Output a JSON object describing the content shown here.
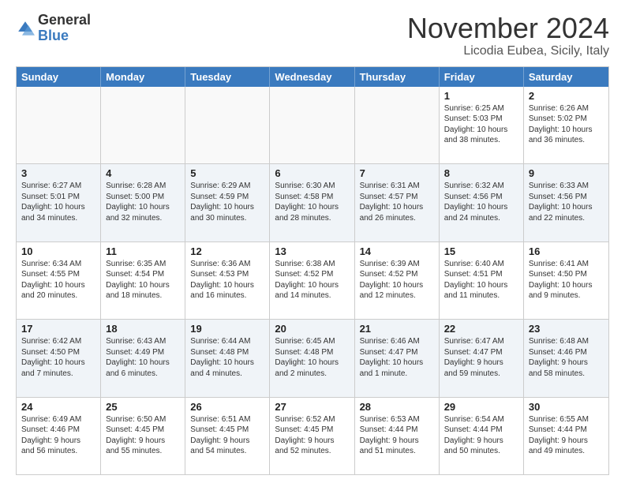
{
  "logo": {
    "general": "General",
    "blue": "Blue"
  },
  "title": "November 2024",
  "subtitle": "Licodia Eubea, Sicily, Italy",
  "headers": [
    "Sunday",
    "Monday",
    "Tuesday",
    "Wednesday",
    "Thursday",
    "Friday",
    "Saturday"
  ],
  "rows": [
    {
      "alt": false,
      "cells": [
        {
          "empty": true,
          "day": "",
          "info": ""
        },
        {
          "empty": true,
          "day": "",
          "info": ""
        },
        {
          "empty": true,
          "day": "",
          "info": ""
        },
        {
          "empty": true,
          "day": "",
          "info": ""
        },
        {
          "empty": true,
          "day": "",
          "info": ""
        },
        {
          "empty": false,
          "day": "1",
          "info": "Sunrise: 6:25 AM\nSunset: 5:03 PM\nDaylight: 10 hours\nand 38 minutes."
        },
        {
          "empty": false,
          "day": "2",
          "info": "Sunrise: 6:26 AM\nSunset: 5:02 PM\nDaylight: 10 hours\nand 36 minutes."
        }
      ]
    },
    {
      "alt": true,
      "cells": [
        {
          "empty": false,
          "day": "3",
          "info": "Sunrise: 6:27 AM\nSunset: 5:01 PM\nDaylight: 10 hours\nand 34 minutes."
        },
        {
          "empty": false,
          "day": "4",
          "info": "Sunrise: 6:28 AM\nSunset: 5:00 PM\nDaylight: 10 hours\nand 32 minutes."
        },
        {
          "empty": false,
          "day": "5",
          "info": "Sunrise: 6:29 AM\nSunset: 4:59 PM\nDaylight: 10 hours\nand 30 minutes."
        },
        {
          "empty": false,
          "day": "6",
          "info": "Sunrise: 6:30 AM\nSunset: 4:58 PM\nDaylight: 10 hours\nand 28 minutes."
        },
        {
          "empty": false,
          "day": "7",
          "info": "Sunrise: 6:31 AM\nSunset: 4:57 PM\nDaylight: 10 hours\nand 26 minutes."
        },
        {
          "empty": false,
          "day": "8",
          "info": "Sunrise: 6:32 AM\nSunset: 4:56 PM\nDaylight: 10 hours\nand 24 minutes."
        },
        {
          "empty": false,
          "day": "9",
          "info": "Sunrise: 6:33 AM\nSunset: 4:56 PM\nDaylight: 10 hours\nand 22 minutes."
        }
      ]
    },
    {
      "alt": false,
      "cells": [
        {
          "empty": false,
          "day": "10",
          "info": "Sunrise: 6:34 AM\nSunset: 4:55 PM\nDaylight: 10 hours\nand 20 minutes."
        },
        {
          "empty": false,
          "day": "11",
          "info": "Sunrise: 6:35 AM\nSunset: 4:54 PM\nDaylight: 10 hours\nand 18 minutes."
        },
        {
          "empty": false,
          "day": "12",
          "info": "Sunrise: 6:36 AM\nSunset: 4:53 PM\nDaylight: 10 hours\nand 16 minutes."
        },
        {
          "empty": false,
          "day": "13",
          "info": "Sunrise: 6:38 AM\nSunset: 4:52 PM\nDaylight: 10 hours\nand 14 minutes."
        },
        {
          "empty": false,
          "day": "14",
          "info": "Sunrise: 6:39 AM\nSunset: 4:52 PM\nDaylight: 10 hours\nand 12 minutes."
        },
        {
          "empty": false,
          "day": "15",
          "info": "Sunrise: 6:40 AM\nSunset: 4:51 PM\nDaylight: 10 hours\nand 11 minutes."
        },
        {
          "empty": false,
          "day": "16",
          "info": "Sunrise: 6:41 AM\nSunset: 4:50 PM\nDaylight: 10 hours\nand 9 minutes."
        }
      ]
    },
    {
      "alt": true,
      "cells": [
        {
          "empty": false,
          "day": "17",
          "info": "Sunrise: 6:42 AM\nSunset: 4:50 PM\nDaylight: 10 hours\nand 7 minutes."
        },
        {
          "empty": false,
          "day": "18",
          "info": "Sunrise: 6:43 AM\nSunset: 4:49 PM\nDaylight: 10 hours\nand 6 minutes."
        },
        {
          "empty": false,
          "day": "19",
          "info": "Sunrise: 6:44 AM\nSunset: 4:48 PM\nDaylight: 10 hours\nand 4 minutes."
        },
        {
          "empty": false,
          "day": "20",
          "info": "Sunrise: 6:45 AM\nSunset: 4:48 PM\nDaylight: 10 hours\nand 2 minutes."
        },
        {
          "empty": false,
          "day": "21",
          "info": "Sunrise: 6:46 AM\nSunset: 4:47 PM\nDaylight: 10 hours\nand 1 minute."
        },
        {
          "empty": false,
          "day": "22",
          "info": "Sunrise: 6:47 AM\nSunset: 4:47 PM\nDaylight: 9 hours\nand 59 minutes."
        },
        {
          "empty": false,
          "day": "23",
          "info": "Sunrise: 6:48 AM\nSunset: 4:46 PM\nDaylight: 9 hours\nand 58 minutes."
        }
      ]
    },
    {
      "alt": false,
      "cells": [
        {
          "empty": false,
          "day": "24",
          "info": "Sunrise: 6:49 AM\nSunset: 4:46 PM\nDaylight: 9 hours\nand 56 minutes."
        },
        {
          "empty": false,
          "day": "25",
          "info": "Sunrise: 6:50 AM\nSunset: 4:45 PM\nDaylight: 9 hours\nand 55 minutes."
        },
        {
          "empty": false,
          "day": "26",
          "info": "Sunrise: 6:51 AM\nSunset: 4:45 PM\nDaylight: 9 hours\nand 54 minutes."
        },
        {
          "empty": false,
          "day": "27",
          "info": "Sunrise: 6:52 AM\nSunset: 4:45 PM\nDaylight: 9 hours\nand 52 minutes."
        },
        {
          "empty": false,
          "day": "28",
          "info": "Sunrise: 6:53 AM\nSunset: 4:44 PM\nDaylight: 9 hours\nand 51 minutes."
        },
        {
          "empty": false,
          "day": "29",
          "info": "Sunrise: 6:54 AM\nSunset: 4:44 PM\nDaylight: 9 hours\nand 50 minutes."
        },
        {
          "empty": false,
          "day": "30",
          "info": "Sunrise: 6:55 AM\nSunset: 4:44 PM\nDaylight: 9 hours\nand 49 minutes."
        }
      ]
    }
  ]
}
